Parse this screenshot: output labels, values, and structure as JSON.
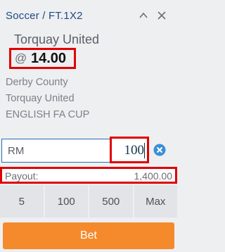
{
  "header": {
    "market": "Soccer / FT.1X2",
    "collapse_icon": "chevron-up-icon",
    "close_icon": "close-icon"
  },
  "selection": {
    "team": "Torquay United",
    "odds_prefix": "@",
    "odds": "14.00"
  },
  "event": {
    "home": "Derby County",
    "away": "Torquay United",
    "competition": "ENGLISH FA CUP"
  },
  "stake": {
    "currency": "RM",
    "value": "100",
    "clear_icon": "clear-x-circle-icon"
  },
  "payout": {
    "label": "Payout:",
    "value": "1,400.00"
  },
  "quick_stakes": [
    "5",
    "100",
    "500",
    "Max"
  ],
  "bet_button": "Bet",
  "colors": {
    "header_text": "#1e4a82",
    "highlight_border": "#e00000",
    "bet_button": "#f58a2c",
    "input_border": "#2b6cb0",
    "clear_icon": "#3a8fd6"
  }
}
